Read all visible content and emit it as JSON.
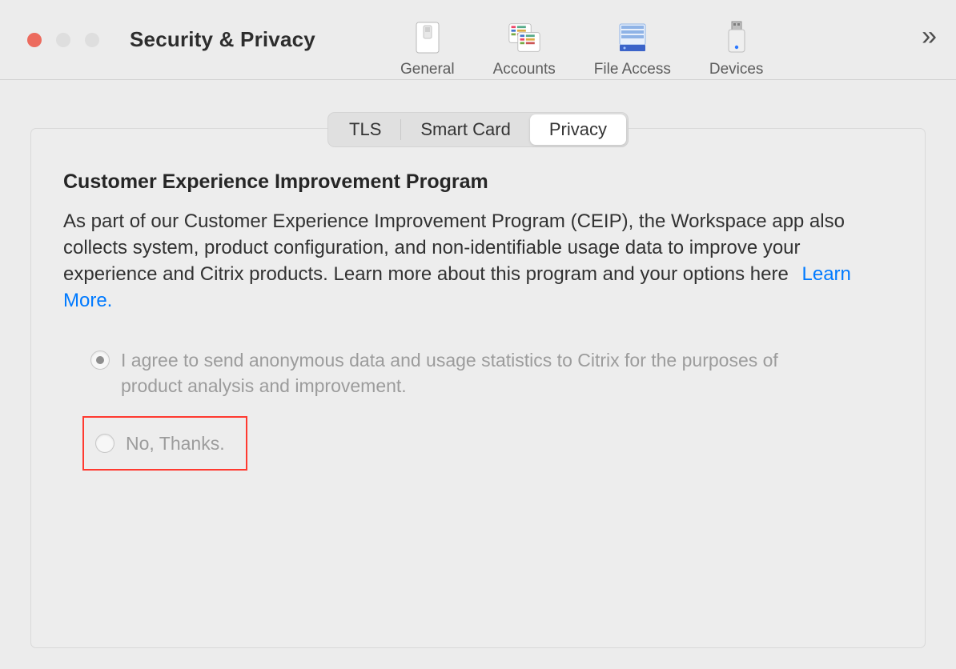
{
  "window": {
    "title": "Security & Privacy"
  },
  "toolbar": {
    "tabs": [
      {
        "label": "General"
      },
      {
        "label": "Accounts"
      },
      {
        "label": "File Access"
      },
      {
        "label": "Devices"
      }
    ],
    "overflow_glyph": "»"
  },
  "segmented": {
    "items": [
      {
        "label": "TLS",
        "active": false
      },
      {
        "label": "Smart Card",
        "active": false
      },
      {
        "label": "Privacy",
        "active": true
      }
    ]
  },
  "section": {
    "title": "Customer Experience Improvement Program",
    "body": "As part of our Customer Experience Improvement Program (CEIP), the Workspace app also collects system, product configuration, and non-identifiable usage data to improve your experience and Citrix products. Learn more about this program and your options here",
    "learn_more": "Learn More."
  },
  "options": {
    "agree": "I agree to send anonymous data and usage statistics to Citrix for the purposes of product analysis and improvement.",
    "decline": "No, Thanks.",
    "selected": "agree"
  }
}
